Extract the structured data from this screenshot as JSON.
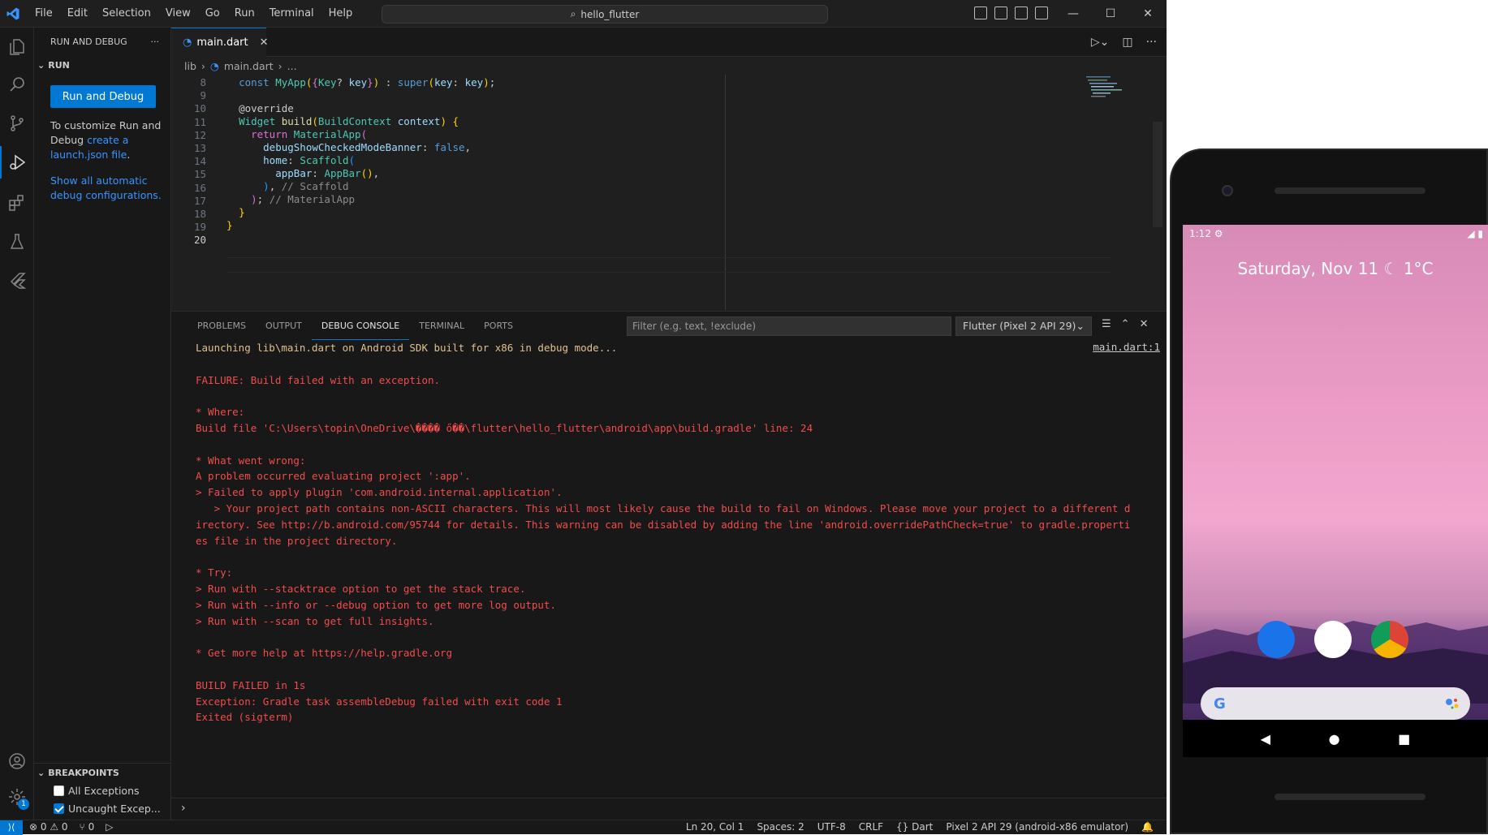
{
  "titlebar": {
    "menu": [
      "File",
      "Edit",
      "Selection",
      "View",
      "Go",
      "Run",
      "Terminal",
      "Help"
    ],
    "search_text": "hello_flutter"
  },
  "sidebar": {
    "title": "RUN AND DEBUG",
    "run_section": "RUN",
    "run_button": "Run and Debug",
    "info_prefix": "To customize Run and Debug ",
    "info_link": "create a launch.json file",
    "info_suffix": ".",
    "show_all": "Show all automatic debug configurations.",
    "breakpoints_section": "BREAKPOINTS",
    "breakpoints": [
      {
        "label": "All Exceptions",
        "checked": false
      },
      {
        "label": "Uncaught Excep...",
        "checked": true
      }
    ]
  },
  "editor": {
    "tab_label": "main.dart",
    "breadcrumb": [
      "lib",
      "main.dart",
      "..."
    ],
    "lines": [
      8,
      9,
      10,
      11,
      12,
      13,
      14,
      15,
      16,
      17,
      18,
      19,
      20
    ],
    "current_line": 20
  },
  "panel": {
    "tabs": [
      "PROBLEMS",
      "OUTPUT",
      "DEBUG CONSOLE",
      "TERMINAL",
      "PORTS"
    ],
    "active_tab": "DEBUG CONSOLE",
    "filter_placeholder": "Filter (e.g. text, !exclude)",
    "device_select": "Flutter (Pixel 2 API 29)",
    "source_link": "main.dart:1",
    "console_lines": [
      "Launching lib\\main.dart on Android SDK built for x86 in debug mode...",
      "",
      "FAILURE: Build failed with an exception.",
      "",
      "* Where:",
      "Build file 'C:\\Users\\topin\\OneDrive\\���� ő��\\flutter\\hello_flutter\\android\\app\\build.gradle' line: 24",
      "",
      "* What went wrong:",
      "A problem occurred evaluating project ':app'.",
      "> Failed to apply plugin 'com.android.internal.application'.",
      "   > Your project path contains non-ASCII characters. This will most likely cause the build to fail on Windows. Please move your project to a different d",
      "irectory. See http://b.android.com/95744 for details. This warning can be disabled by adding the line 'android.overridePathCheck=true' to gradle.properti",
      "es file in the project directory.",
      "",
      "* Try:",
      "> Run with --stacktrace option to get the stack trace.",
      "> Run with --info or --debug option to get more log output.",
      "> Run with --scan to get full insights.",
      "",
      "* Get more help at https://help.gradle.org",
      "",
      "BUILD FAILED in 1s",
      "Exception: Gradle task assembleDebug failed with exit code 1",
      "Exited (sigterm)"
    ]
  },
  "statusbar": {
    "errors": "0",
    "warnings": "0",
    "ports": "0",
    "position": "Ln 20, Col 1",
    "spaces": "Spaces: 2",
    "encoding": "UTF-8",
    "eol": "CRLF",
    "language": "Dart",
    "device": "Pixel 2 API 29 (android-x86 emulator)"
  },
  "phone": {
    "time": "1:12",
    "date": "Saturday, Nov 11",
    "weather": "1°C"
  }
}
